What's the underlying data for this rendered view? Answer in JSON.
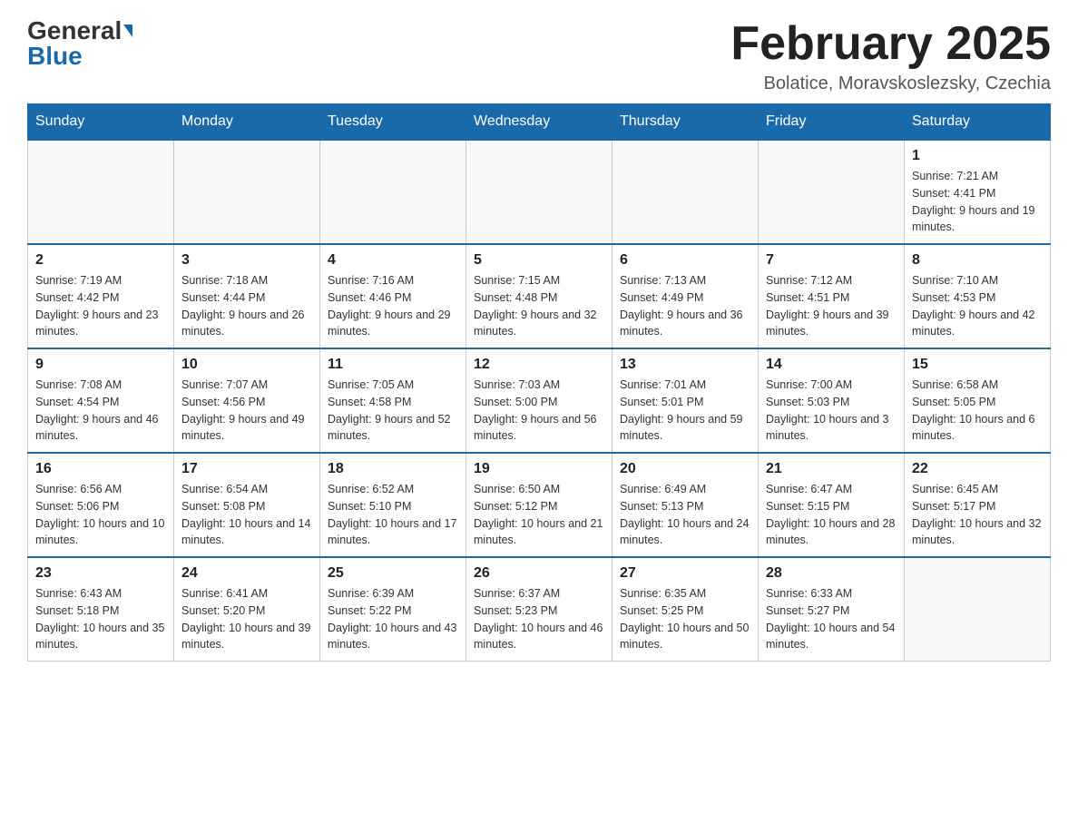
{
  "header": {
    "logo_general": "General",
    "logo_blue": "Blue",
    "month_title": "February 2025",
    "location": "Bolatice, Moravskoslezsky, Czechia"
  },
  "weekdays": [
    "Sunday",
    "Monday",
    "Tuesday",
    "Wednesday",
    "Thursday",
    "Friday",
    "Saturday"
  ],
  "weeks": [
    [
      {
        "day": "",
        "info": ""
      },
      {
        "day": "",
        "info": ""
      },
      {
        "day": "",
        "info": ""
      },
      {
        "day": "",
        "info": ""
      },
      {
        "day": "",
        "info": ""
      },
      {
        "day": "",
        "info": ""
      },
      {
        "day": "1",
        "info": "Sunrise: 7:21 AM\nSunset: 4:41 PM\nDaylight: 9 hours and 19 minutes."
      }
    ],
    [
      {
        "day": "2",
        "info": "Sunrise: 7:19 AM\nSunset: 4:42 PM\nDaylight: 9 hours and 23 minutes."
      },
      {
        "day": "3",
        "info": "Sunrise: 7:18 AM\nSunset: 4:44 PM\nDaylight: 9 hours and 26 minutes."
      },
      {
        "day": "4",
        "info": "Sunrise: 7:16 AM\nSunset: 4:46 PM\nDaylight: 9 hours and 29 minutes."
      },
      {
        "day": "5",
        "info": "Sunrise: 7:15 AM\nSunset: 4:48 PM\nDaylight: 9 hours and 32 minutes."
      },
      {
        "day": "6",
        "info": "Sunrise: 7:13 AM\nSunset: 4:49 PM\nDaylight: 9 hours and 36 minutes."
      },
      {
        "day": "7",
        "info": "Sunrise: 7:12 AM\nSunset: 4:51 PM\nDaylight: 9 hours and 39 minutes."
      },
      {
        "day": "8",
        "info": "Sunrise: 7:10 AM\nSunset: 4:53 PM\nDaylight: 9 hours and 42 minutes."
      }
    ],
    [
      {
        "day": "9",
        "info": "Sunrise: 7:08 AM\nSunset: 4:54 PM\nDaylight: 9 hours and 46 minutes."
      },
      {
        "day": "10",
        "info": "Sunrise: 7:07 AM\nSunset: 4:56 PM\nDaylight: 9 hours and 49 minutes."
      },
      {
        "day": "11",
        "info": "Sunrise: 7:05 AM\nSunset: 4:58 PM\nDaylight: 9 hours and 52 minutes."
      },
      {
        "day": "12",
        "info": "Sunrise: 7:03 AM\nSunset: 5:00 PM\nDaylight: 9 hours and 56 minutes."
      },
      {
        "day": "13",
        "info": "Sunrise: 7:01 AM\nSunset: 5:01 PM\nDaylight: 9 hours and 59 minutes."
      },
      {
        "day": "14",
        "info": "Sunrise: 7:00 AM\nSunset: 5:03 PM\nDaylight: 10 hours and 3 minutes."
      },
      {
        "day": "15",
        "info": "Sunrise: 6:58 AM\nSunset: 5:05 PM\nDaylight: 10 hours and 6 minutes."
      }
    ],
    [
      {
        "day": "16",
        "info": "Sunrise: 6:56 AM\nSunset: 5:06 PM\nDaylight: 10 hours and 10 minutes."
      },
      {
        "day": "17",
        "info": "Sunrise: 6:54 AM\nSunset: 5:08 PM\nDaylight: 10 hours and 14 minutes."
      },
      {
        "day": "18",
        "info": "Sunrise: 6:52 AM\nSunset: 5:10 PM\nDaylight: 10 hours and 17 minutes."
      },
      {
        "day": "19",
        "info": "Sunrise: 6:50 AM\nSunset: 5:12 PM\nDaylight: 10 hours and 21 minutes."
      },
      {
        "day": "20",
        "info": "Sunrise: 6:49 AM\nSunset: 5:13 PM\nDaylight: 10 hours and 24 minutes."
      },
      {
        "day": "21",
        "info": "Sunrise: 6:47 AM\nSunset: 5:15 PM\nDaylight: 10 hours and 28 minutes."
      },
      {
        "day": "22",
        "info": "Sunrise: 6:45 AM\nSunset: 5:17 PM\nDaylight: 10 hours and 32 minutes."
      }
    ],
    [
      {
        "day": "23",
        "info": "Sunrise: 6:43 AM\nSunset: 5:18 PM\nDaylight: 10 hours and 35 minutes."
      },
      {
        "day": "24",
        "info": "Sunrise: 6:41 AM\nSunset: 5:20 PM\nDaylight: 10 hours and 39 minutes."
      },
      {
        "day": "25",
        "info": "Sunrise: 6:39 AM\nSunset: 5:22 PM\nDaylight: 10 hours and 43 minutes."
      },
      {
        "day": "26",
        "info": "Sunrise: 6:37 AM\nSunset: 5:23 PM\nDaylight: 10 hours and 46 minutes."
      },
      {
        "day": "27",
        "info": "Sunrise: 6:35 AM\nSunset: 5:25 PM\nDaylight: 10 hours and 50 minutes."
      },
      {
        "day": "28",
        "info": "Sunrise: 6:33 AM\nSunset: 5:27 PM\nDaylight: 10 hours and 54 minutes."
      },
      {
        "day": "",
        "info": ""
      }
    ]
  ]
}
